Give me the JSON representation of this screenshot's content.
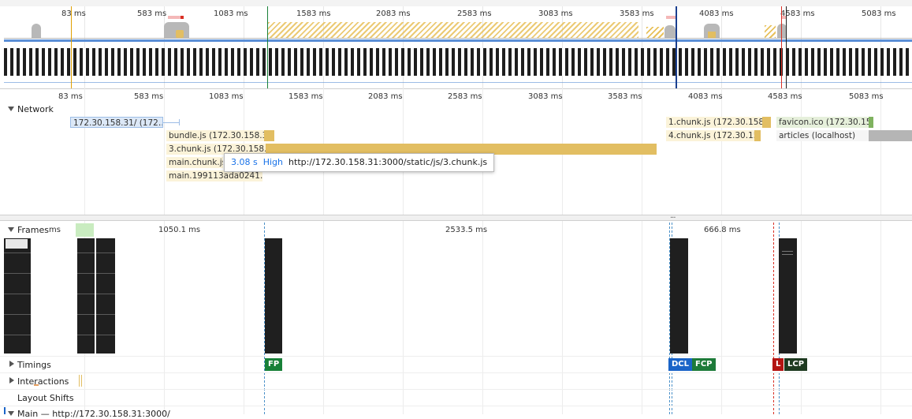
{
  "ruler_ticks": [
    "83 ms",
    "583 ms",
    "1083 ms",
    "1583 ms",
    "2083 ms",
    "2583 ms",
    "3083 ms",
    "3583 ms",
    "4083 ms",
    "4583 ms",
    "5083 ms"
  ],
  "tracks": {
    "network": "Network",
    "frames": "Frames",
    "frames_unit": "ms",
    "timings": "Timings",
    "interactions": "Interactions",
    "layout_shifts": "Layout Shifts",
    "main": "Main — http://172.30.158.31:3000/"
  },
  "network_requests": [
    {
      "name": "172.30.158.31/ (172…",
      "type": "document"
    },
    {
      "name": "bundle.js (172.30.158.31)",
      "type": "script"
    },
    {
      "name": "3.chunk.js (172.30.158.31)",
      "type": "script"
    },
    {
      "name": "main.chunk.js",
      "type": "script"
    },
    {
      "name": "main.199113ada0241…",
      "type": "script"
    },
    {
      "name": "1.chunk.js (172.30.158.31)",
      "type": "script"
    },
    {
      "name": "4.chunk.js (172.30.15…",
      "type": "script"
    },
    {
      "name": "favicon.ico (172.30.15…",
      "type": "image"
    },
    {
      "name": "articles (localhost)",
      "type": "fetch"
    }
  ],
  "tooltip": {
    "duration": "3.08 s",
    "priority": "High",
    "url": "http://172.30.158.31:3000/static/js/3.chunk.js"
  },
  "frame_durations": [
    "1050.1 ms",
    "2533.5 ms",
    "666.8 ms"
  ],
  "timing_markers": [
    {
      "label": "FP",
      "color": "#188038"
    },
    {
      "label": "DCL",
      "color": "#1a64c8"
    },
    {
      "label": "FCP",
      "color": "#1e7b3a"
    },
    {
      "label": "L",
      "color": "#b31412"
    },
    {
      "label": "LCP",
      "color": "#1e3a20"
    }
  ],
  "colors": {
    "network_line": "#5b8fd6",
    "script": "#e2be62",
    "document": "#9dbde6",
    "image": "#7fb25f",
    "xhr": "#b5b5b5",
    "link": "#1a73e8"
  },
  "expand_more": "..."
}
